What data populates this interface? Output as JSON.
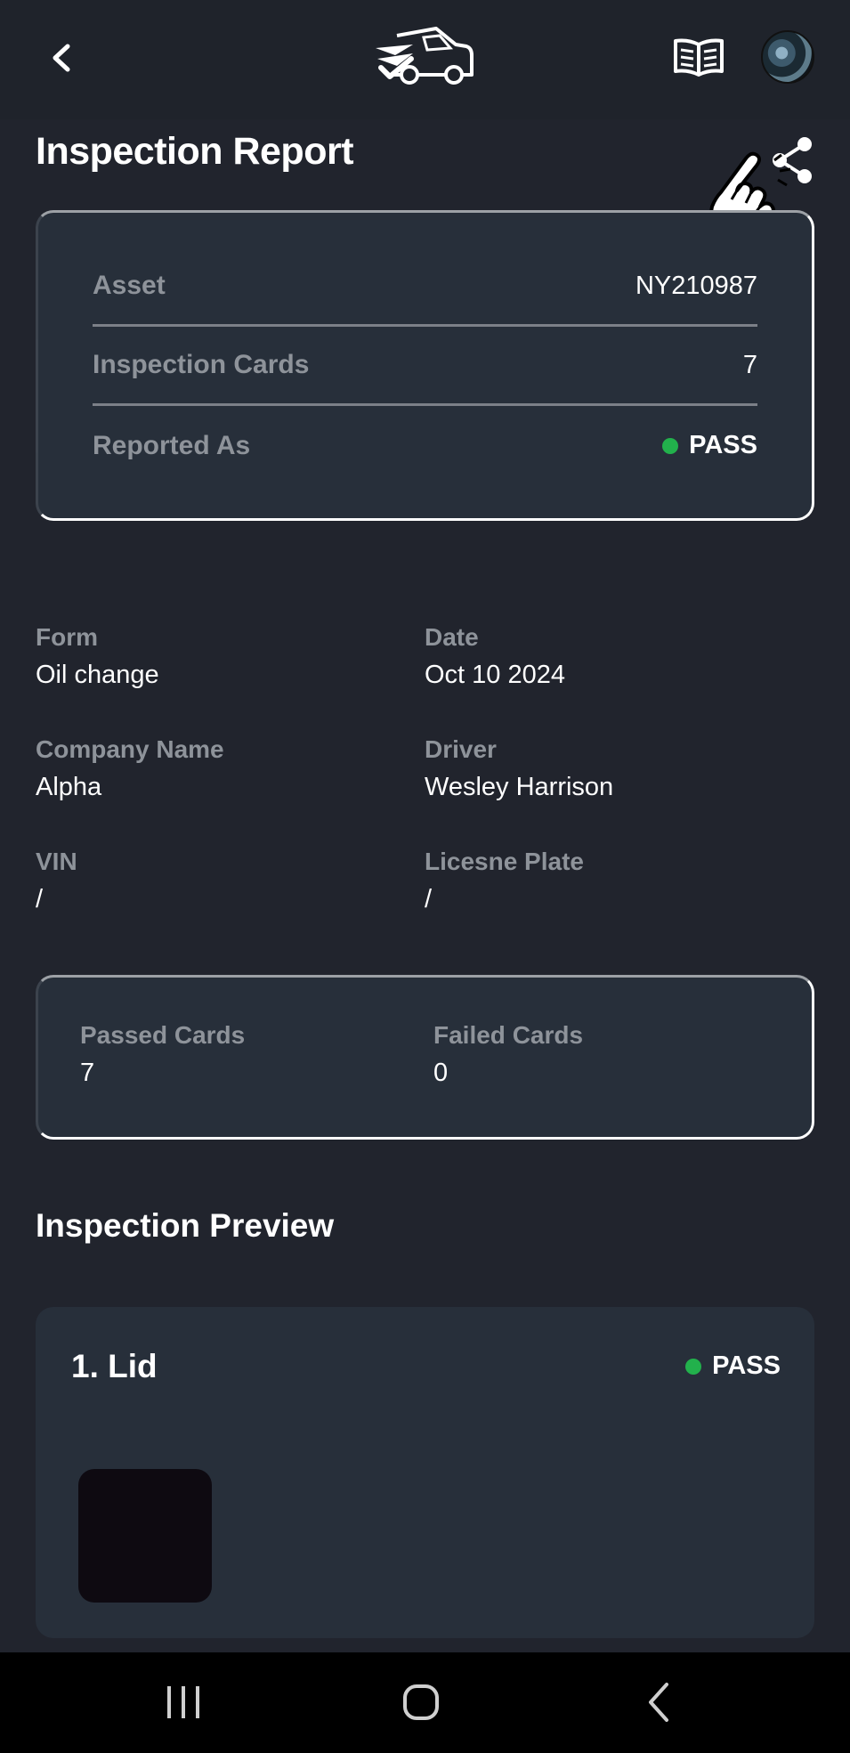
{
  "header": {
    "back_icon": "chevron-left-icon",
    "logo_icon": "truck-checkmark-logo",
    "manual_icon": "open-book-icon",
    "avatar_icon": "user-avatar"
  },
  "page": {
    "title": "Inspection Report",
    "share_icon": "share-icon",
    "pointer_icon": "tapping-hand-icon"
  },
  "summary": {
    "asset_label": "Asset",
    "asset_value": "NY210987",
    "cards_label": "Inspection Cards",
    "cards_value": "7",
    "reported_label": "Reported As",
    "reported_value": "PASS",
    "reported_color": "#22b14c"
  },
  "details": {
    "form_label": "Form",
    "form_value": "Oil change",
    "date_label": "Date",
    "date_value": "Oct 10 2024",
    "company_label": "Company Name",
    "company_value": "Alpha",
    "driver_label": "Driver",
    "driver_value": "Wesley Harrison",
    "vin_label": "VIN",
    "vin_value": "/",
    "plate_label": "Licesne Plate",
    "plate_value": "/"
  },
  "counts": {
    "passed_label": "Passed Cards",
    "passed_value": "7",
    "failed_label": "Failed Cards",
    "failed_value": "0"
  },
  "preview": {
    "section_title": "Inspection Preview",
    "items": [
      {
        "title": "1. Lid",
        "status": "PASS",
        "status_color": "#22b14c"
      }
    ]
  },
  "system_nav": {
    "recents_icon": "recent-apps-icon",
    "home_icon": "home-icon",
    "back_icon": "back-icon"
  },
  "colors": {
    "background": "#21242d",
    "card": "#272f3a",
    "muted_text": "#8e939a",
    "pass_green": "#22b14c"
  }
}
